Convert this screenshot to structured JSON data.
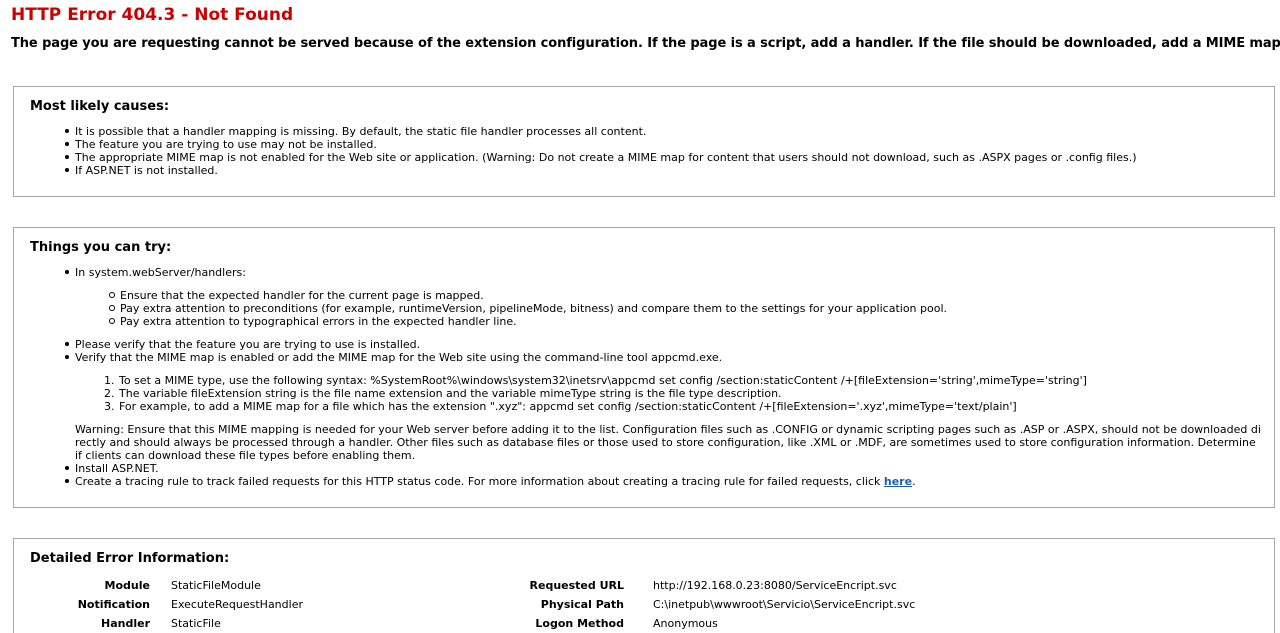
{
  "title": "HTTP Error 404.3 - Not Found",
  "subtitle": "The page you are requesting cannot be served because of the extension configuration. If the page is a script, add a handler. If the file should be downloaded, add a MIME map.",
  "causes": {
    "heading": "Most likely causes:",
    "items": [
      "It is possible that a handler mapping is missing. By default, the static file handler processes all content.",
      "The feature you are trying to use may not be installed.",
      "The appropriate MIME map is not enabled for the Web site or application. (Warning: Do not create a MIME map for content that users should not download, such as .ASPX pages or .config files.)",
      "If ASP.NET is not installed."
    ]
  },
  "try": {
    "heading": "Things you can try:",
    "item1": "In system.webServer/handlers:",
    "sub1": [
      "Ensure that the expected handler for the current page is mapped.",
      "Pay extra attention to preconditions (for example, runtimeVersion, pipelineMode, bitness) and compare them to the settings for your application pool.",
      "Pay extra attention to typographical errors in the expected handler line."
    ],
    "item2": "Please verify that the feature you are trying to use is installed.",
    "item3": "Verify that the MIME map is enabled or add the MIME map for the Web site using the command-line tool appcmd.exe.",
    "steps": [
      {
        "num": "1.",
        "text": "To set a MIME type, use the following syntax: %SystemRoot%\\windows\\system32\\inetsrv\\appcmd set config /section:staticContent /+[fileExtension='string',mimeType='string']"
      },
      {
        "num": "2.",
        "text": "The variable fileExtension string is the file name extension and the variable mimeType string is the file type description."
      },
      {
        "num": "3.",
        "text": "For example, to add a MIME map for a file which has the extension \".xyz\": appcmd set config /section:staticContent /+[fileExtension='.xyz',mimeType='text/plain']"
      }
    ],
    "warning": "Warning: Ensure that this MIME mapping is needed for your Web server before adding it to the list. Configuration files such as .CONFIG or dynamic scripting pages such as .ASP or .ASPX, should not be downloaded directly and should always be processed through a handler. Other files such as database files or those used to store configuration, like .XML or .MDF, are sometimes used to store configuration information. Determine if clients can download these file types before enabling them.",
    "item4": "Install ASP.NET.",
    "item5_text": "Create a tracing rule to track failed requests for this HTTP status code. For more information about creating a tracing rule for failed requests, click ",
    "item5_link": "here",
    "item5_end": "."
  },
  "details": {
    "heading": "Detailed Error Information:",
    "left": [
      {
        "label": "Module",
        "value": "StaticFileModule"
      },
      {
        "label": "Notification",
        "value": "ExecuteRequestHandler"
      },
      {
        "label": "Handler",
        "value": "StaticFile"
      }
    ],
    "right": [
      {
        "label": "Requested URL",
        "value": "http://192.168.0.23:8080/ServiceEncript.svc"
      },
      {
        "label": "Physical Path",
        "value": "C:\\inetpub\\wwwroot\\Servicio\\ServiceEncript.svc"
      },
      {
        "label": "Logon Method",
        "value": "Anonymous"
      }
    ]
  },
  "colors": {
    "title": "#cc0000",
    "link": "#1f5fb2",
    "border": "#a6a6a6"
  }
}
